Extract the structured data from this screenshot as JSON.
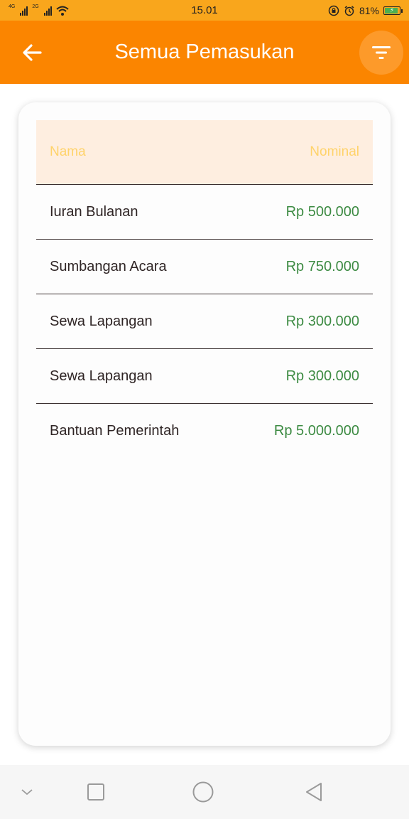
{
  "status_bar": {
    "time": "15.01",
    "network_1": "4G",
    "network_2": "2G",
    "battery_text": "81%",
    "battery_level": 0.81,
    "icons": [
      "signal-icon",
      "signal-icon",
      "wifi-icon",
      "lock-rotation-icon",
      "alarm-icon",
      "battery-icon"
    ]
  },
  "app_bar": {
    "title": "Semua Pemasukan",
    "back_icon": "arrow-left-icon",
    "filter_icon": "filter-icon",
    "background_color": "#fb8500"
  },
  "table": {
    "columns": [
      "Nama",
      "Nominal"
    ],
    "rows": [
      {
        "name": "Iuran Bulanan",
        "amount": "Rp 500.000"
      },
      {
        "name": "Sumbangan Acara",
        "amount": "Rp 750.000"
      },
      {
        "name": "Sewa Lapangan",
        "amount": "Rp 300.000"
      },
      {
        "name": "Sewa Lapangan",
        "amount": "Rp 300.000"
      },
      {
        "name": "Bantuan Pemerintah",
        "amount": "Rp 5.000.000"
      }
    ],
    "header_color": "#ffd36b",
    "amount_color": "#3d8b43"
  },
  "nav_bar": {
    "icons": [
      "chevron-down-icon",
      "square-icon",
      "circle-icon",
      "triangle-back-icon"
    ]
  }
}
